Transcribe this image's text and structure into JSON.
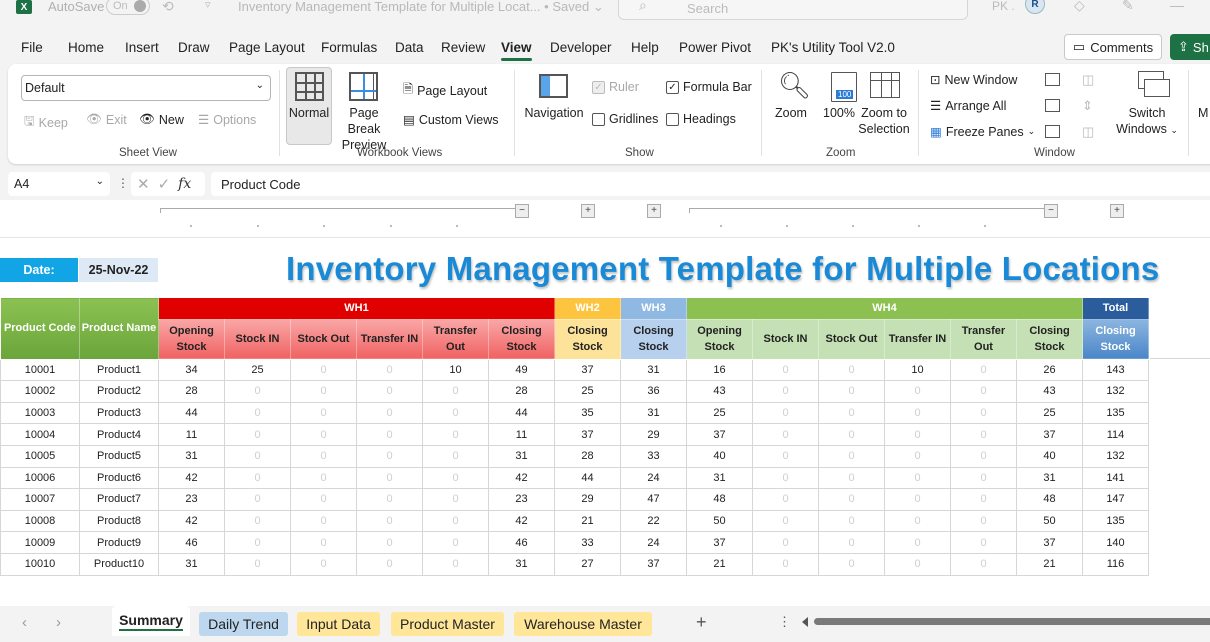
{
  "titlebar": {
    "app_icon": "excel-logo",
    "autosave_label": "AutoSave",
    "autosave_state": "On",
    "document_title": "Inventory Management Template for Multiple Locat...",
    "save_status": "• Saved",
    "search_placeholder": "Search",
    "user_initials": "PK .",
    "avatar_text": "R"
  },
  "menu": {
    "items": [
      "File",
      "Home",
      "Insert",
      "Draw",
      "Page Layout",
      "Formulas",
      "Data",
      "Review",
      "View",
      "Developer",
      "Help",
      "Power Pivot",
      "PK's Utility Tool V2.0"
    ],
    "active": "View",
    "comments_label": "Comments",
    "share_label": "Sh"
  },
  "ribbon": {
    "sheet_view": {
      "label": "Sheet View",
      "select_value": "Default",
      "keep": "Keep",
      "exit": "Exit",
      "new": "New",
      "options": "Options"
    },
    "workbook_views": {
      "label": "Workbook Views",
      "normal": "Normal",
      "page_break_preview_1": "Page Break",
      "page_break_preview_2": "Preview",
      "page_layout": "Page Layout",
      "custom_views": "Custom Views"
    },
    "show": {
      "label": "Show",
      "navigation": "Navigation",
      "ruler": "Ruler",
      "ruler_checked": true,
      "formula_bar": "Formula Bar",
      "formula_bar_checked": true,
      "gridlines": "Gridlines",
      "gridlines_checked": false,
      "headings": "Headings",
      "headings_checked": false
    },
    "zoom": {
      "label": "Zoom",
      "zoom": "Zoom",
      "hundred": "100%",
      "hundred_badge": "100",
      "zoom_to_selection_1": "Zoom to",
      "zoom_to_selection_2": "Selection"
    },
    "window": {
      "label": "Window",
      "new_window": "New Window",
      "arrange_all": "Arrange All",
      "freeze_panes": "Freeze Panes",
      "switch_windows_1": "Switch",
      "switch_windows_2": "Windows"
    },
    "macros_partial": "M"
  },
  "formula_bar": {
    "name_box": "A4",
    "formula": "Product Code"
  },
  "sheet": {
    "date_label": "Date:",
    "date_value": "25-Nov-22",
    "title": "Inventory Management Template for Multiple Locations",
    "colors": {
      "wh1": "#e00000",
      "wh2": "#fdc440",
      "wh3": "#8fb8e2",
      "wh4": "#8cc152",
      "total": "#2b5d9c",
      "title": "#1a8ad6",
      "date_label_bg": "#12a5e6"
    },
    "headers": {
      "product_code": "Product Code",
      "product_name": "Product Name",
      "wh1": "WH1",
      "wh2": "WH2",
      "wh3": "WH3",
      "wh4": "WH4",
      "total": "Total",
      "opening_stock": "Opening Stock",
      "stock_in": "Stock IN",
      "stock_out": "Stock Out",
      "transfer_in": "Transfer IN",
      "transfer_out": "Transfer Out",
      "closing_stock": "Closing Stock"
    },
    "rows": [
      {
        "code": "10001",
        "name": "Product1",
        "wh1": [
          34,
          25,
          0,
          0,
          10,
          49
        ],
        "wh2": 37,
        "wh3": 31,
        "wh4": [
          16,
          0,
          0,
          10,
          0,
          26
        ],
        "total": 143
      },
      {
        "code": "10002",
        "name": "Product2",
        "wh1": [
          28,
          0,
          0,
          0,
          0,
          28
        ],
        "wh2": 25,
        "wh3": 36,
        "wh4": [
          43,
          0,
          0,
          0,
          0,
          43
        ],
        "total": 132
      },
      {
        "code": "10003",
        "name": "Product3",
        "wh1": [
          44,
          0,
          0,
          0,
          0,
          44
        ],
        "wh2": 35,
        "wh3": 31,
        "wh4": [
          25,
          0,
          0,
          0,
          0,
          25
        ],
        "total": 135
      },
      {
        "code": "10004",
        "name": "Product4",
        "wh1": [
          11,
          0,
          0,
          0,
          0,
          11
        ],
        "wh2": 37,
        "wh3": 29,
        "wh4": [
          37,
          0,
          0,
          0,
          0,
          37
        ],
        "total": 114
      },
      {
        "code": "10005",
        "name": "Product5",
        "wh1": [
          31,
          0,
          0,
          0,
          0,
          31
        ],
        "wh2": 28,
        "wh3": 33,
        "wh4": [
          40,
          0,
          0,
          0,
          0,
          40
        ],
        "total": 132
      },
      {
        "code": "10006",
        "name": "Product6",
        "wh1": [
          42,
          0,
          0,
          0,
          0,
          42
        ],
        "wh2": 44,
        "wh3": 24,
        "wh4": [
          31,
          0,
          0,
          0,
          0,
          31
        ],
        "total": 141
      },
      {
        "code": "10007",
        "name": "Product7",
        "wh1": [
          23,
          0,
          0,
          0,
          0,
          23
        ],
        "wh2": 29,
        "wh3": 47,
        "wh4": [
          48,
          0,
          0,
          0,
          0,
          48
        ],
        "total": 147
      },
      {
        "code": "10008",
        "name": "Product8",
        "wh1": [
          42,
          0,
          0,
          0,
          0,
          42
        ],
        "wh2": 21,
        "wh3": 22,
        "wh4": [
          50,
          0,
          0,
          0,
          0,
          50
        ],
        "total": 135
      },
      {
        "code": "10009",
        "name": "Product9",
        "wh1": [
          46,
          0,
          0,
          0,
          0,
          46
        ],
        "wh2": 33,
        "wh3": 24,
        "wh4": [
          37,
          0,
          0,
          0,
          0,
          37
        ],
        "total": 140
      },
      {
        "code": "10010",
        "name": "Product10",
        "wh1": [
          31,
          0,
          0,
          0,
          0,
          31
        ],
        "wh2": 27,
        "wh3": 37,
        "wh4": [
          21,
          0,
          0,
          0,
          0,
          21
        ],
        "total": 116
      }
    ]
  },
  "tabs": {
    "items": [
      {
        "label": "Summary",
        "color": "#ffffff",
        "active": true
      },
      {
        "label": "Daily Trend",
        "color": "#bdd7ee",
        "active": false
      },
      {
        "label": "Input Data",
        "color": "#ffe699",
        "active": false
      },
      {
        "label": "Product Master",
        "color": "#ffe699",
        "active": false
      },
      {
        "label": "Warehouse Master",
        "color": "#ffe699",
        "active": false
      }
    ],
    "add_label": "+"
  }
}
